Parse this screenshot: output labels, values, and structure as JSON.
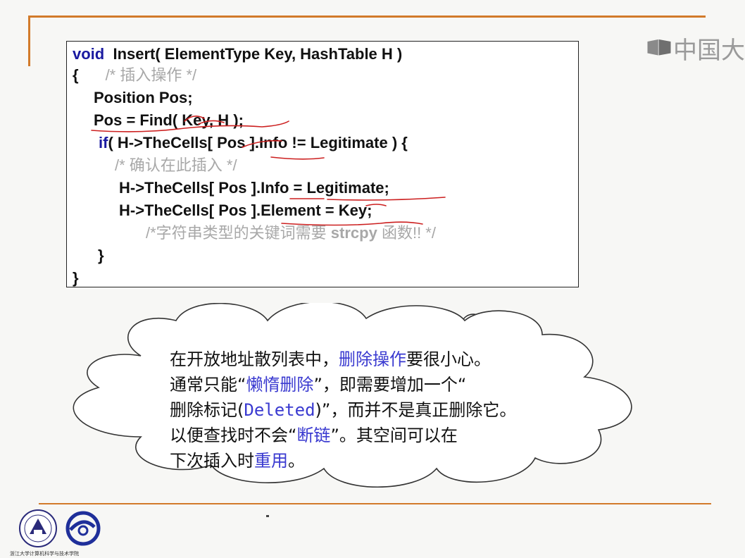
{
  "watermark": {
    "text": "中国大"
  },
  "code": {
    "line1_void": "void",
    "line1_rest": "  Insert( ElementType Key, HashTable H )",
    "line2_brace": "{",
    "line2_comment": "/* 插入操作 */",
    "line3": "Position Pos;",
    "line4": "Pos = Find( Key, H );",
    "line5_if": "if",
    "line5_rest": "( H->TheCells[ Pos ].Info != Legitimate ) {",
    "line6_comment": "/* 确认在此插入 */",
    "line7": "H->TheCells[ Pos ].Info = Legitimate;",
    "line8": "H->TheCells[ Pos ].Element = Key;",
    "line9_comment_a": "/*字符串类型的关键词需要 ",
    "line9_comment_b": "strcpy",
    "line9_comment_c": " 函数!! */",
    "line10": "}",
    "line11": "}"
  },
  "note": {
    "l1a": "在开放地址散列表中，",
    "l1b": "删除操作",
    "l1c": "要很小心。",
    "l2a": "通常只能“",
    "l2b": "懒惰删除",
    "l2c": "”，即需要增加一个“",
    "l3a": "删除标记(",
    "l3b": "Deleted",
    "l3c": ")”，而并不是真正删除它。",
    "l4a": "以便查找时不会“",
    "l4b": "断链",
    "l4c": "”。其空间可以在",
    "l5a": "下次插入时",
    "l5b": "重用",
    "l5c": "。"
  },
  "footer": {
    "text": "浙江大学计算机科学与技术学院"
  },
  "colors": {
    "accent_rule": "#d27a2a",
    "keyword": "#1a1aa0",
    "highlight": "#3a3ad0",
    "ink_red": "#cc1f1f",
    "comment": "#a8a8a8"
  }
}
